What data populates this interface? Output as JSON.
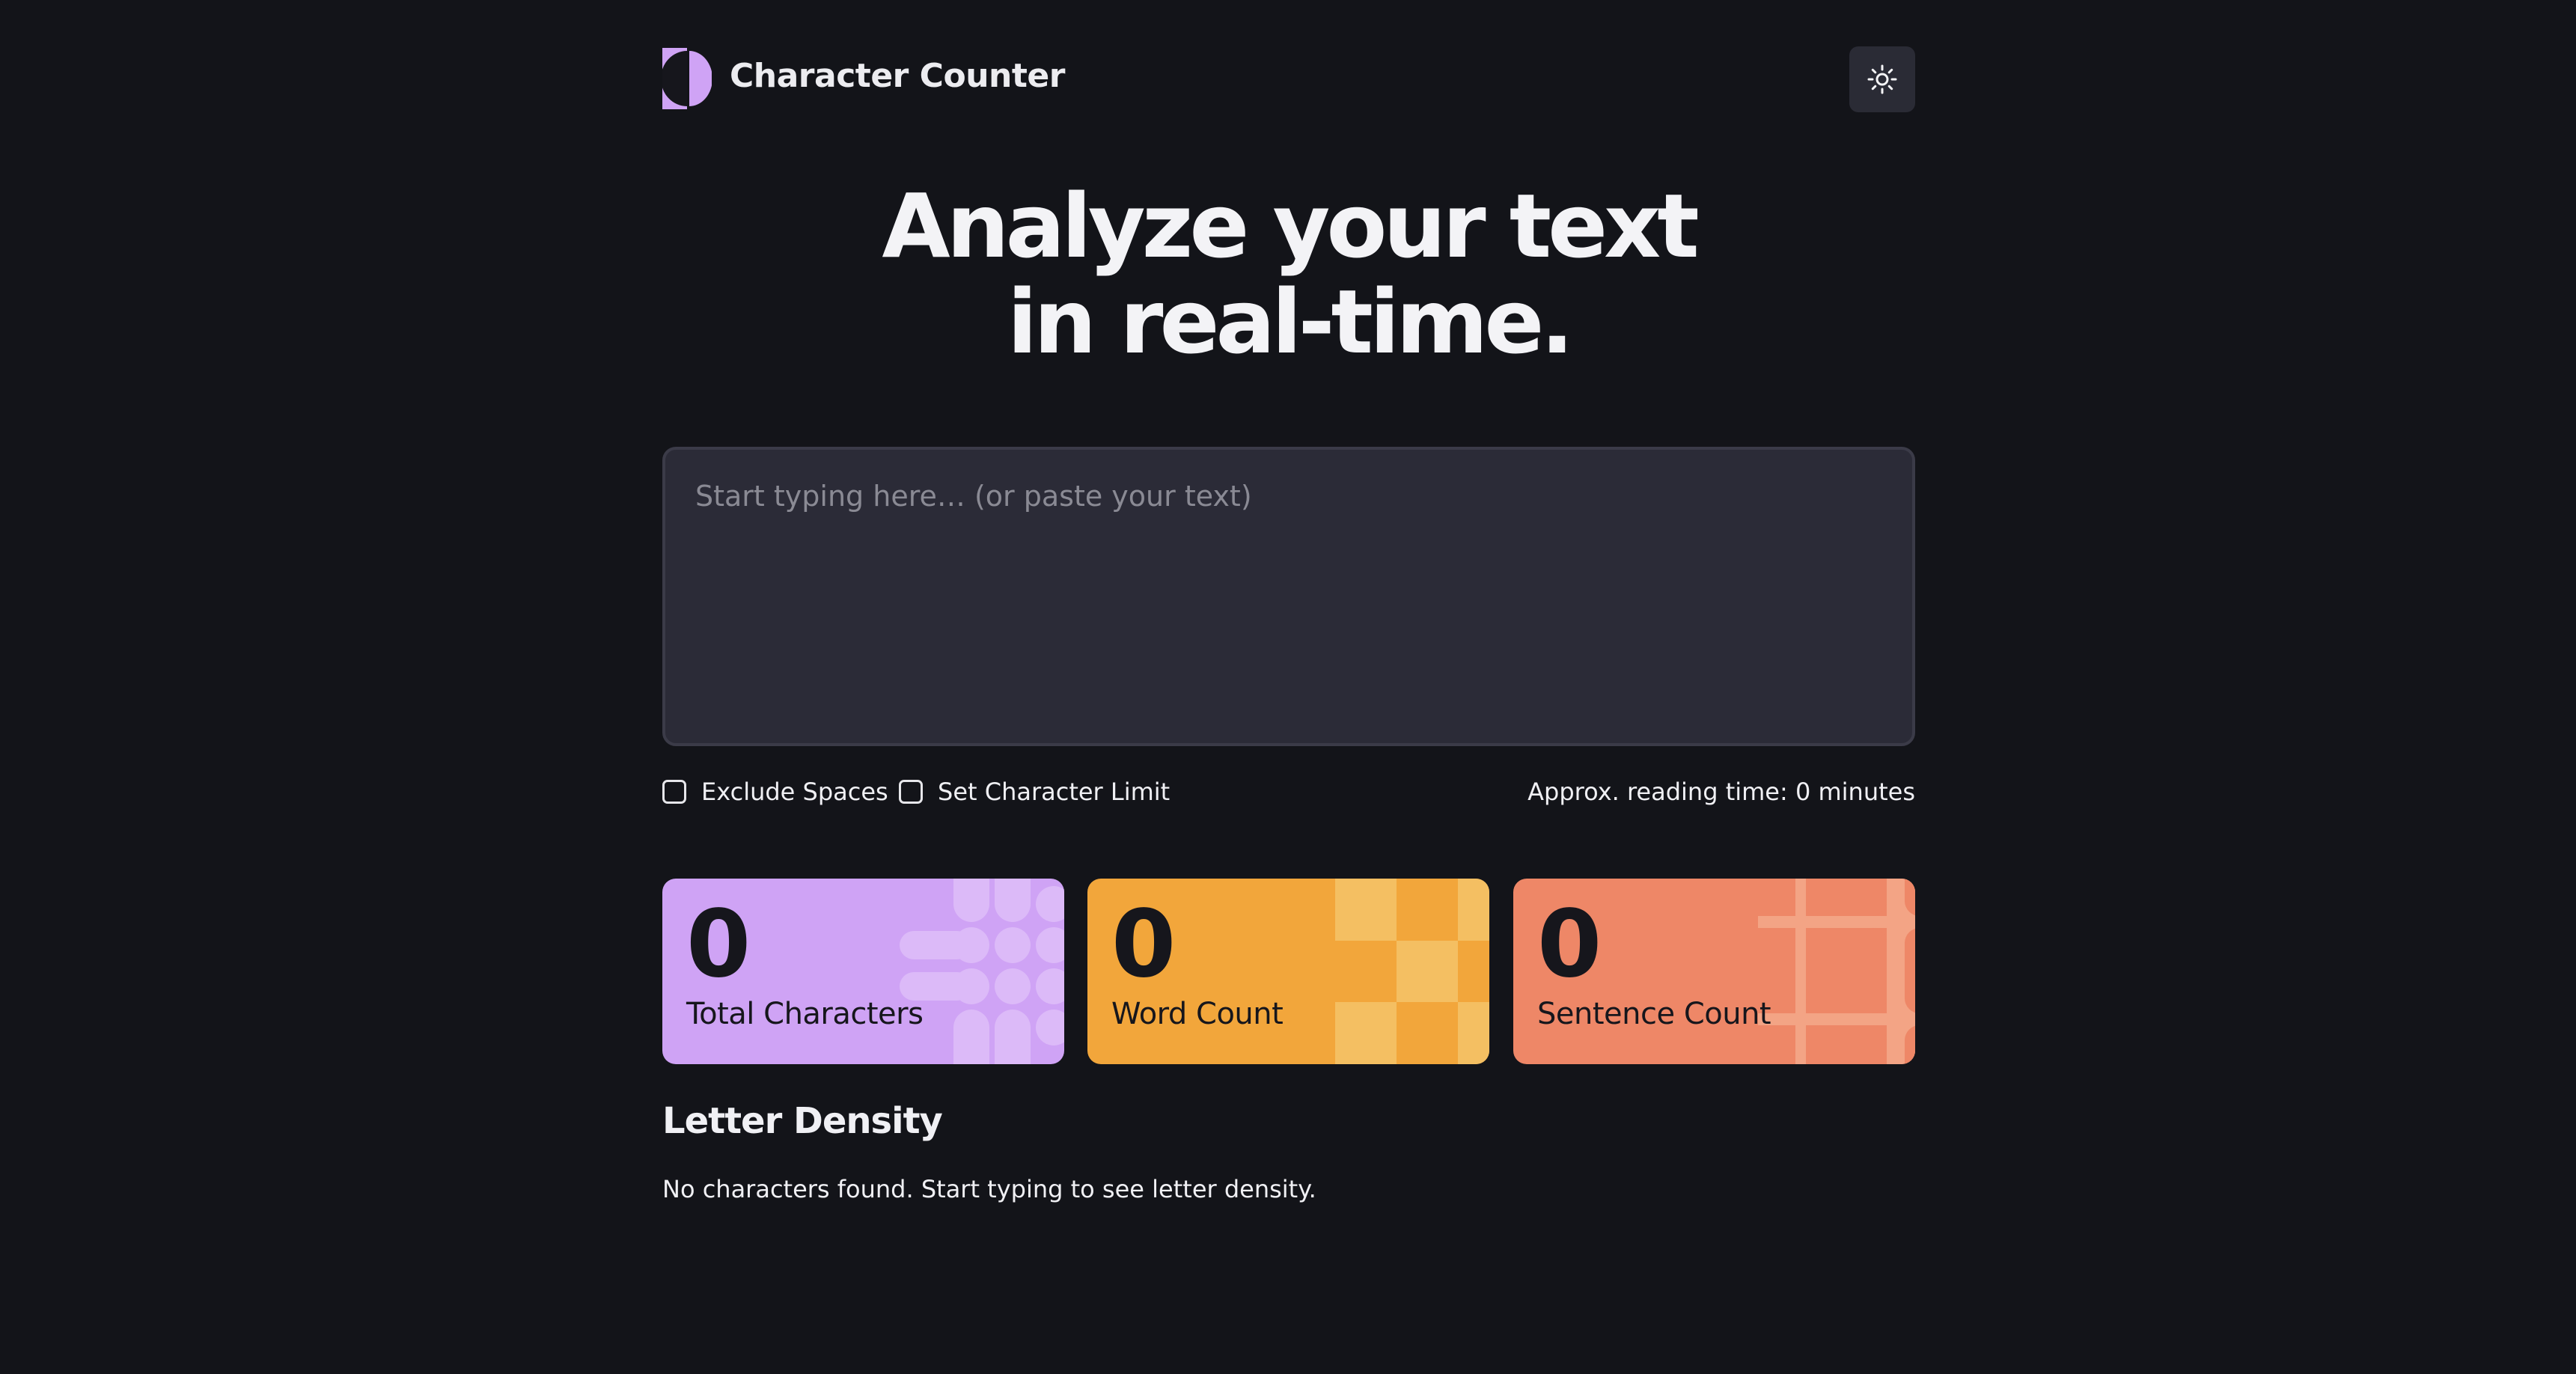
{
  "header": {
    "app_title": "Character Counter",
    "theme_toggle_icon": "sun-icon"
  },
  "hero": {
    "line1": "Analyze your text",
    "line2": "in real-time."
  },
  "editor": {
    "placeholder": "Start typing here… (or paste your text)",
    "value": ""
  },
  "options": {
    "exclude_spaces_label": "Exclude Spaces",
    "exclude_spaces_checked": false,
    "char_limit_label": "Set Character Limit",
    "char_limit_checked": false,
    "reading_time": "Approx. reading time: 0 minutes"
  },
  "stats": {
    "total_characters": {
      "value": "0",
      "label": "Total Characters",
      "color": "#cfa3f5"
    },
    "word_count": {
      "value": "0",
      "label": "Word Count",
      "color": "#f2a63b"
    },
    "sentence_count": {
      "value": "0",
      "label": "Sentence Count",
      "color": "#ee8767"
    }
  },
  "density": {
    "title": "Letter Density",
    "empty_message": "No characters found. Start typing to see letter density."
  },
  "colors": {
    "background": "#131419",
    "accent": "#cfa3f5",
    "panel": "#2b2b37"
  }
}
